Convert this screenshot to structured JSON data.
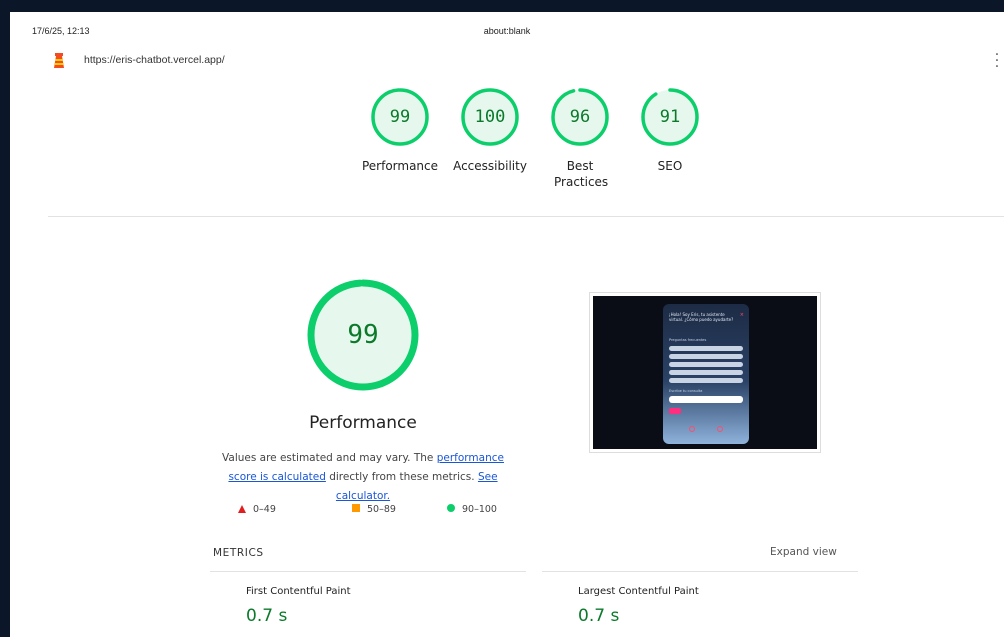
{
  "print_header": {
    "date": "17/6/25, 12:13",
    "title": "about:blank"
  },
  "urlbar": {
    "url": "https://eris-chatbot.vercel.app/"
  },
  "icons": {
    "logo": "lighthouse-icon",
    "menu": "more-vert-icon"
  },
  "colors": {
    "pass": "#0cce6b",
    "pass_text": "#0b7a2b",
    "fail": "#e01e1e",
    "average": "#ff9900",
    "link": "#1a56d6"
  },
  "gauges": [
    {
      "score": "99",
      "label": "Performance",
      "fraction": 0.99
    },
    {
      "score": "100",
      "label": "Accessibility",
      "fraction": 1.0
    },
    {
      "score": "96",
      "label": "Best Practices",
      "fraction": 0.96
    },
    {
      "score": "91",
      "label": "SEO",
      "fraction": 0.91
    }
  ],
  "performance": {
    "score": "99",
    "fraction": 0.99,
    "title": "Performance",
    "desc_prefix": "Values are estimated and may vary. The ",
    "desc_link1": "performance score is calculated",
    "desc_mid": " directly from these metrics. ",
    "desc_link2": "See calculator."
  },
  "legend": [
    {
      "label": "0–49",
      "marker": "triangle"
    },
    {
      "label": "50–89",
      "marker": "square"
    },
    {
      "label": "90–100",
      "marker": "circle"
    }
  ],
  "screenshot": {
    "greeting": "¡Hola! Soy Eris, tu asistente virtual. ¿Cómo puedo ayudarte?",
    "section": "Preguntas frecuentes",
    "prompt": "Escribe tu consulta",
    "send": "Enviar"
  },
  "metrics": {
    "title": "METRICS",
    "expand": "Expand view",
    "items": [
      {
        "name": "First Contentful Paint",
        "value": "0.7 s"
      },
      {
        "name": "Largest Contentful Paint",
        "value": "0.7 s"
      }
    ]
  }
}
